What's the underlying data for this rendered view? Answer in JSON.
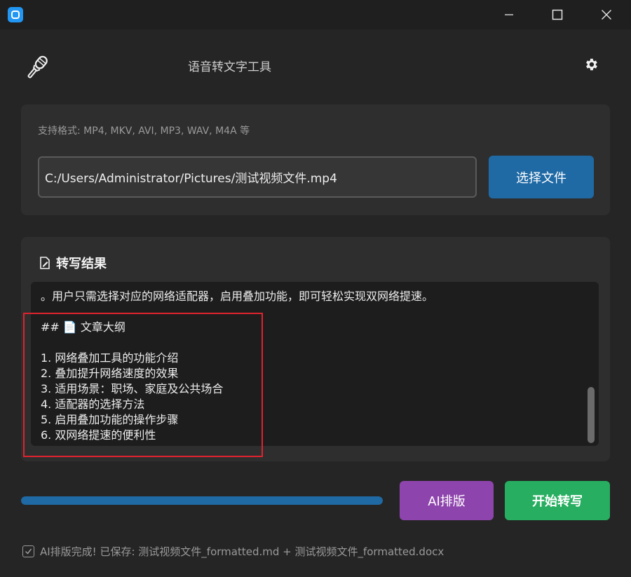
{
  "window": {
    "app_icon": "app-icon",
    "controls": [
      "minimize-icon",
      "maximize-icon",
      "close-icon"
    ]
  },
  "header": {
    "title": "语音转文字工具",
    "logo_icon": "microphone-icon",
    "settings_icon": "gear-icon"
  },
  "file_panel": {
    "formats_label": "支持格式: MP4, MKV, AVI, MP3, WAV, M4A 等",
    "path_value": "C:/Users/Administrator/Pictures/测试视频文件.mp4",
    "select_button": "选择文件"
  },
  "result_panel": {
    "heading": "转写结果",
    "heading_icon": "edit-document-icon",
    "text": "。用户只需选择对应的网络适配器，启用叠加功能，即可轻松实现双网络提速。\n\n## 📄 文章大纲\n\n1. 网络叠加工具的功能介绍\n2. 叠加提升网络速度的效果\n3. 适用场景：职场、家庭及公共场合\n4. 适配器的选择方法\n5. 启用叠加功能的操作步骤\n6. 双网络提速的便利性"
  },
  "footer": {
    "progress": 1.0,
    "ai_button": "AI排版",
    "start_button": "开始转写",
    "status_text": "AI排版完成! 已保存: 测试视频文件_formatted.md + 测试视频文件_formatted.docx",
    "status_icon": "checkbox-icon"
  },
  "colors": {
    "accent_blue": "#1f6aa5",
    "ai_purple": "#8e44ad",
    "start_green": "#27ae60",
    "highlight_red": "#e0232e"
  }
}
